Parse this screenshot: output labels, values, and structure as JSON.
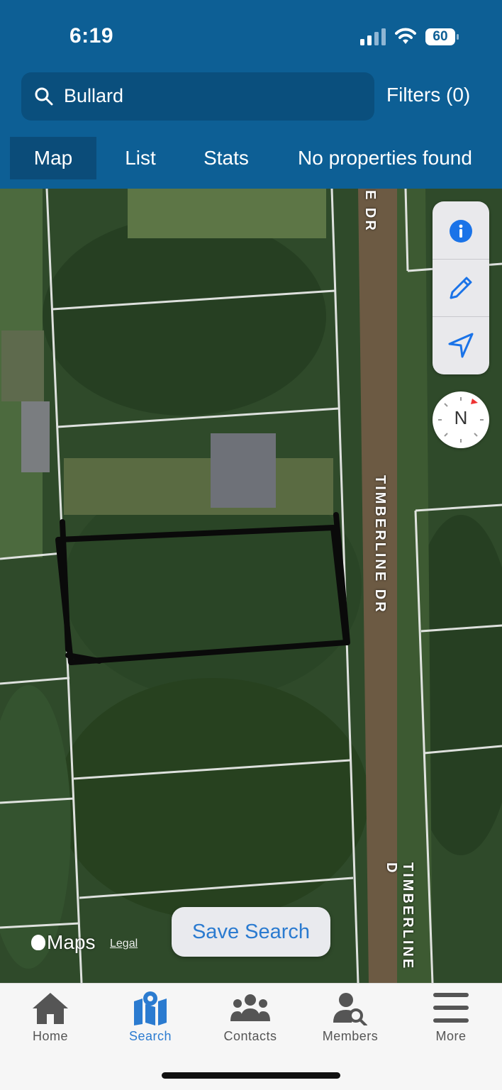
{
  "status_bar": {
    "time": "6:19",
    "battery": "60"
  },
  "search": {
    "query": "Bullard",
    "filters_label": "Filters (0)"
  },
  "tabs": [
    {
      "label": "Map",
      "active": true
    },
    {
      "label": "List",
      "active": false
    },
    {
      "label": "Stats",
      "active": false
    }
  ],
  "results_status": "No properties found",
  "map": {
    "road_labels": [
      "TIMBERLINE DR",
      "E DR",
      "TIMBERLINE D"
    ],
    "attribution": "Maps",
    "legal": "Legal",
    "compass": "N",
    "controls": [
      "info-icon",
      "pencil-icon",
      "location-arrow-icon"
    ]
  },
  "save_search_label": "Save Search",
  "bottom_nav": [
    {
      "label": "Home",
      "icon": "home-icon",
      "active": false
    },
    {
      "label": "Search",
      "icon": "map-pin-icon",
      "active": true
    },
    {
      "label": "Contacts",
      "icon": "people-icon",
      "active": false
    },
    {
      "label": "Members",
      "icon": "member-search-icon",
      "active": false
    },
    {
      "label": "More",
      "icon": "menu-icon",
      "active": false
    }
  ],
  "colors": {
    "header": "#0d5f95",
    "accent": "#2b7bd0",
    "inactive": "#555555"
  }
}
